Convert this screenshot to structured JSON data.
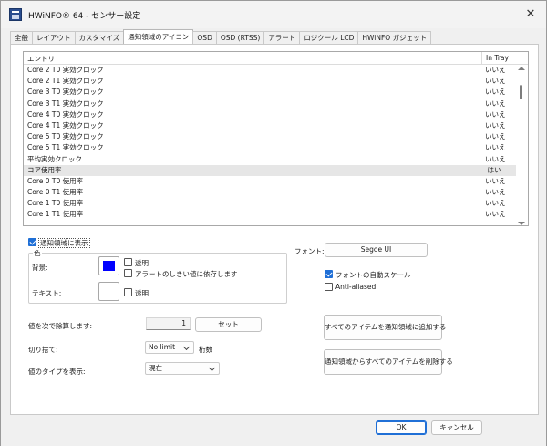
{
  "window": {
    "title": "HWiNFO® 64 - センサー設定",
    "close_glyph": "✕"
  },
  "tabs": [
    {
      "label": "全般",
      "active": false
    },
    {
      "label": "レイアウト",
      "active": false
    },
    {
      "label": "カスタマイズ",
      "active": false
    },
    {
      "label": "通知領域のアイコン",
      "active": true
    },
    {
      "label": "OSD",
      "active": false
    },
    {
      "label": "OSD (RTSS)",
      "active": false
    },
    {
      "label": "アラート",
      "active": false
    },
    {
      "label": "ロジクール LCD",
      "active": false
    },
    {
      "label": "HWiNFO ガジェット",
      "active": false
    }
  ],
  "list": {
    "columns": {
      "entry": "エントリ",
      "in_tray": "In Tray"
    },
    "rows": [
      {
        "entry": "Core 2 T0 実効クロック",
        "in_tray": "いいえ"
      },
      {
        "entry": "Core 2 T1 実効クロック",
        "in_tray": "いいえ"
      },
      {
        "entry": "Core 3 T0 実効クロック",
        "in_tray": "いいえ"
      },
      {
        "entry": "Core 3 T1 実効クロック",
        "in_tray": "いいえ"
      },
      {
        "entry": "Core 4 T0 実効クロック",
        "in_tray": "いいえ"
      },
      {
        "entry": "Core 4 T1 実効クロック",
        "in_tray": "いいえ"
      },
      {
        "entry": "Core 5 T0 実効クロック",
        "in_tray": "いいえ"
      },
      {
        "entry": "Core 5 T1 実効クロック",
        "in_tray": "いいえ"
      },
      {
        "entry": "平均実効クロック",
        "in_tray": "いいえ"
      },
      {
        "entry": "コア使用率",
        "in_tray": "はい"
      },
      {
        "entry": "Core 0 T0 使用率",
        "in_tray": "いいえ"
      },
      {
        "entry": "Core 0 T1 使用率",
        "in_tray": "いいえ"
      },
      {
        "entry": "Core 1 T0 使用率",
        "in_tray": "いいえ"
      },
      {
        "entry": "Core 1 T1 使用率",
        "in_tray": "いいえ"
      }
    ],
    "selected_index": 9
  },
  "tray": {
    "show_in_tray": "通知領域に表示",
    "show_in_tray_checked": true,
    "color_group": "色",
    "background_label": "背景:",
    "background_color": "#0000ff",
    "transparent_1": "透明",
    "depend_alert": "アラートのしきい値に依存します",
    "text_label": "テキスト:",
    "text_color": "#ffffff",
    "transparent_2": "透明"
  },
  "font": {
    "label": "フォント:",
    "button": "Segoe UI",
    "auto_scale": "フォントの自動スケール",
    "auto_scale_checked": true,
    "anti_aliased": "Anti-aliased",
    "anti_aliased_checked": false
  },
  "divide": {
    "label": "値を次で除算します:",
    "value": "1",
    "set_button": "セット"
  },
  "truncate": {
    "label": "切り捨て:",
    "value": "No limit",
    "suffix": "桁数"
  },
  "value_type": {
    "label": "値のタイプを表示:",
    "value": "現在"
  },
  "actions": {
    "add_all": "すべてのアイテムを通知領域に追加する",
    "remove_all": "通知領域からすべてのアイテムを削除する"
  },
  "footer": {
    "ok": "OK",
    "cancel": "キャンセル"
  }
}
